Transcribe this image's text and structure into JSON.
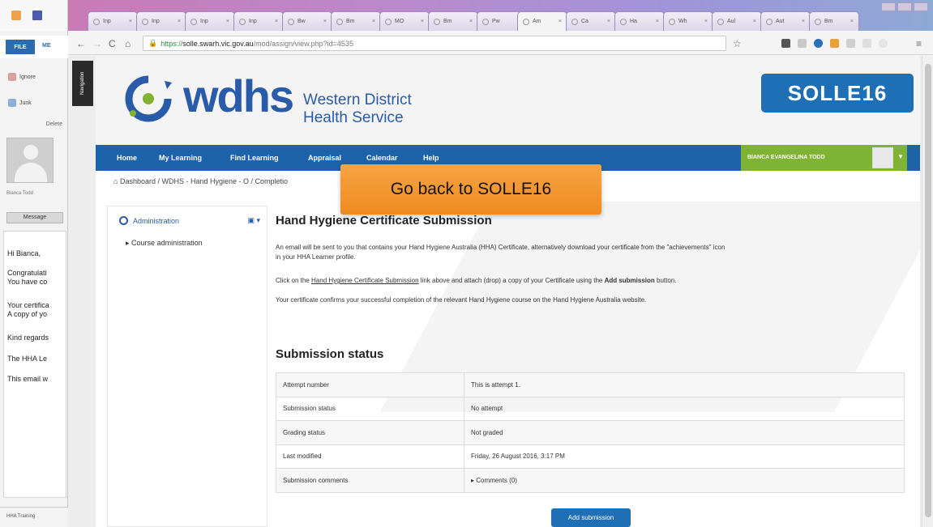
{
  "outlook": {
    "tab_file": "FILE",
    "tab_message": "ME",
    "cmd_ignore": "Ignore",
    "cmd_junk": "Junk",
    "group_delete": "Delete",
    "to_name": "Bianca Todd",
    "message_label": "Message",
    "body_lines": [
      "Hi Bianca,",
      "Congratulati",
      "You have co",
      "Your certifica",
      "A copy of yo",
      "Kind regards",
      "The HHA Le",
      "This email w"
    ],
    "footer": "HHA Training"
  },
  "browser": {
    "tabs": [
      "Inp",
      "Inp",
      "Inp",
      "Inp",
      "Bw",
      "Bm",
      "MO",
      "Bm",
      "Pw",
      "Am",
      "Ca",
      "Ha",
      "Wh",
      "Aul",
      "Aut",
      "Bm"
    ],
    "url_scheme": "https://",
    "url_host": "solle.swarh.vic.gov.au",
    "url_path": "/mod/assign/view.php?id=4535"
  },
  "nav_drawer_label": "Navigation",
  "site": {
    "logo_text": "wdhs",
    "logo_sub_line1": "Western District",
    "logo_sub_line2": "Health Service",
    "solle_label": "SOLLE16"
  },
  "menu": {
    "items": [
      "Home",
      "My Learning",
      "Find Learning",
      "Appraisal",
      "Calendar",
      "Help"
    ],
    "user_name": "BIANCA EVANGELINA TODD"
  },
  "breadcrumb": "Dashboard / WDHS - Hand Hygiene - O / Completio",
  "callout": "Go back to SOLLE16",
  "admin": {
    "title": "Administration",
    "item": "Course administration"
  },
  "main": {
    "title": "Hand Hygiene Certificate Submission",
    "para1": "An email will be sent to you that contains your Hand Hygiene Australia (HHA) Certificate, alternatively download your certificate from the \"achievements\" icon",
    "para1b": "in your HHA Learner profile.",
    "para2_pre": "Click on the ",
    "para2_link": "Hand Hygiene Certificate Submission",
    "para2_mid": " link above and attach (drop) a copy of your Certificate using the ",
    "para2_bold": "Add submission",
    "para2_post": " button.",
    "para3": "Your certificate confirms your successful completion of the relevant Hand Hygiene course on the Hand Hygiene Australia website.",
    "status_title": "Submission status",
    "rows": [
      {
        "k": "Attempt number",
        "v": "This is attempt 1."
      },
      {
        "k": "Submission status",
        "v": "No attempt"
      },
      {
        "k": "Grading status",
        "v": "Not graded"
      },
      {
        "k": "Last modified",
        "v": "Friday, 26 August 2016, 3:17 PM"
      },
      {
        "k": "Submission comments",
        "v": "Comments (0)"
      }
    ],
    "add_button": "Add submission"
  }
}
